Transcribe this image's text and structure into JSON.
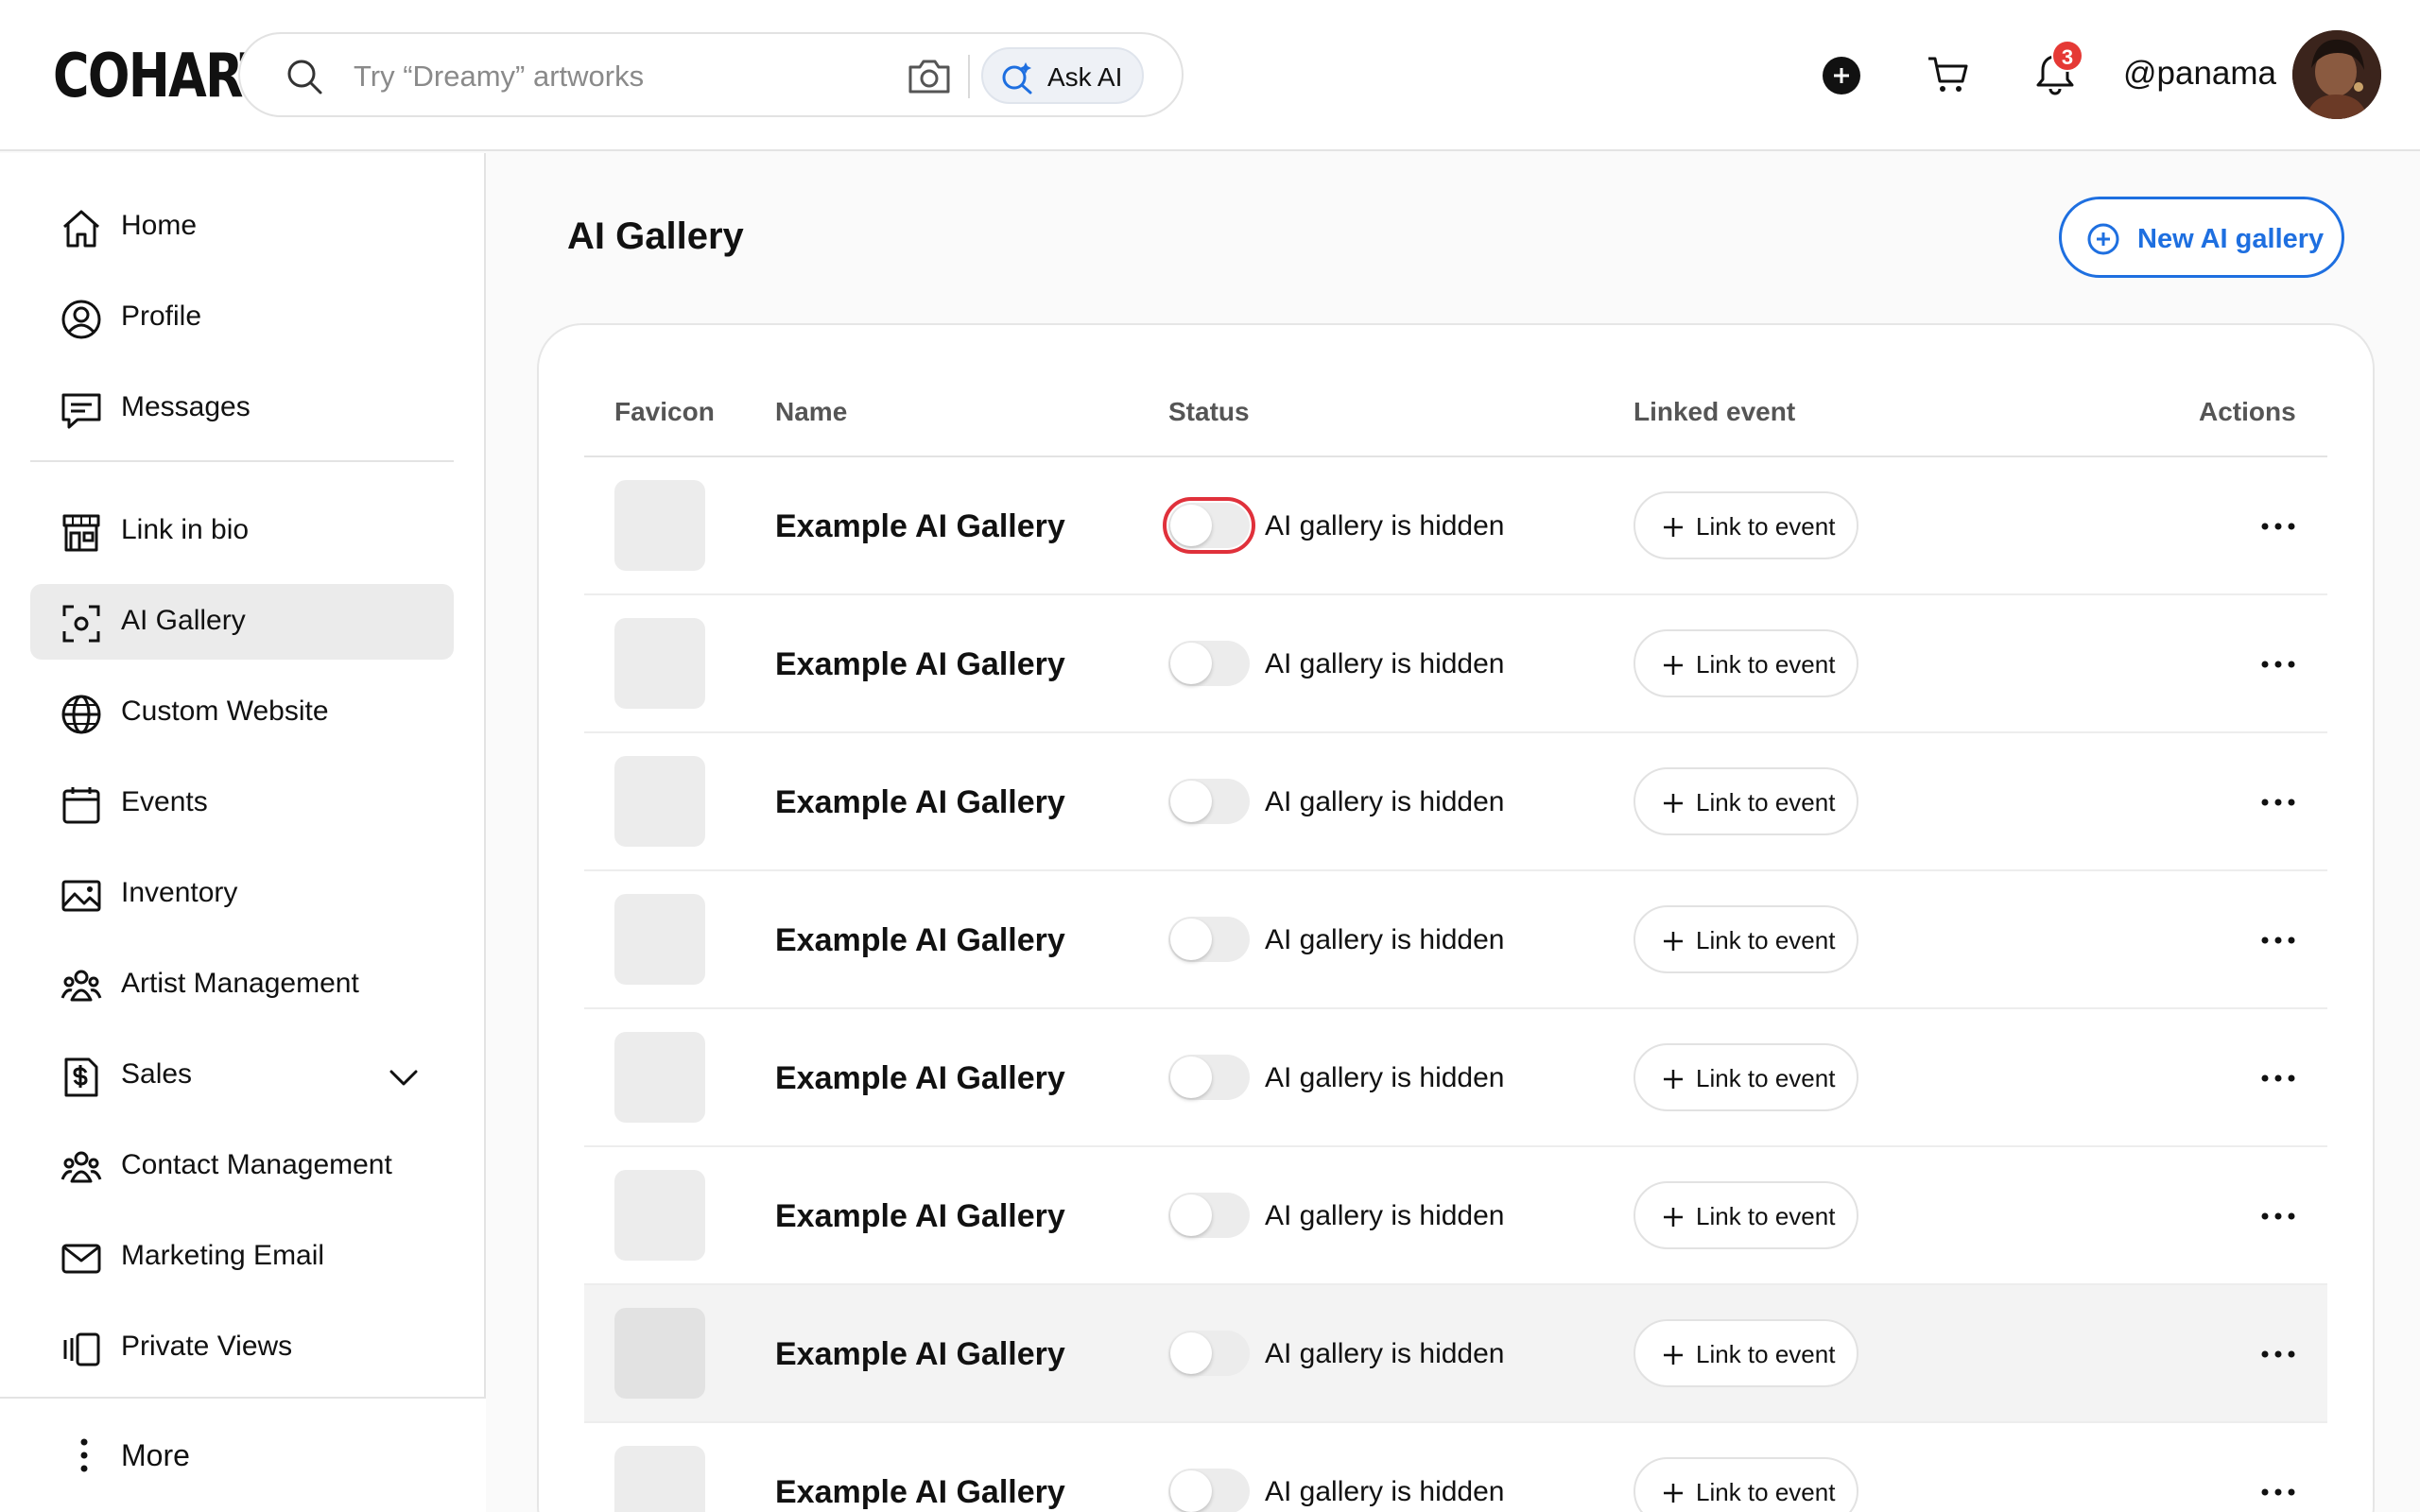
{
  "header": {
    "logo": "COHART",
    "search_placeholder": "Try “Dreamy” artworks",
    "ask_ai_label": "Ask AI",
    "notification_count": "3",
    "username": "@panama"
  },
  "sidebar": {
    "items": [
      {
        "label": "Home",
        "icon": "home-icon"
      },
      {
        "label": "Profile",
        "icon": "profile-icon"
      },
      {
        "label": "Messages",
        "icon": "messages-icon"
      },
      {
        "label": "Link in bio",
        "icon": "storefront-icon"
      },
      {
        "label": "AI Gallery",
        "icon": "scan-icon",
        "active": true
      },
      {
        "label": "Custom Website",
        "icon": "globe-icon"
      },
      {
        "label": "Events",
        "icon": "calendar-icon"
      },
      {
        "label": "Inventory",
        "icon": "image-icon"
      },
      {
        "label": "Artist Management",
        "icon": "people-icon"
      },
      {
        "label": "Sales",
        "icon": "dollar-doc-icon"
      },
      {
        "label": "Contact Management",
        "icon": "people-icon"
      },
      {
        "label": "Marketing Email",
        "icon": "mail-icon"
      },
      {
        "label": "Private Views",
        "icon": "carousel-icon"
      }
    ],
    "more_label": "More"
  },
  "main": {
    "title": "AI Gallery",
    "new_button_label": "New AI gallery",
    "columns": {
      "favicon": "Favicon",
      "name": "Name",
      "status": "Status",
      "linked_event": "Linked event",
      "actions": "Actions"
    },
    "rows": [
      {
        "name": "Example AI Gallery",
        "status": "AI gallery is hidden",
        "link_label": "Link to event"
      },
      {
        "name": "Example AI Gallery",
        "status": "AI gallery is hidden",
        "link_label": "Link to event"
      },
      {
        "name": "Example AI Gallery",
        "status": "AI gallery is hidden",
        "link_label": "Link to event"
      },
      {
        "name": "Example AI Gallery",
        "status": "AI gallery is hidden",
        "link_label": "Link to event"
      },
      {
        "name": "Example AI Gallery",
        "status": "AI gallery is hidden",
        "link_label": "Link to event"
      },
      {
        "name": "Example AI Gallery",
        "status": "AI gallery is hidden",
        "link_label": "Link to event"
      },
      {
        "name": "Example AI Gallery",
        "status": "AI gallery is hidden",
        "link_label": "Link to event"
      },
      {
        "name": "Example AI Gallery",
        "status": "AI gallery is hidden",
        "link_label": "Link to event"
      }
    ]
  },
  "colors": {
    "accent": "#1e6fe0",
    "badge": "#e53935",
    "focus_ring": "#e0313b"
  }
}
